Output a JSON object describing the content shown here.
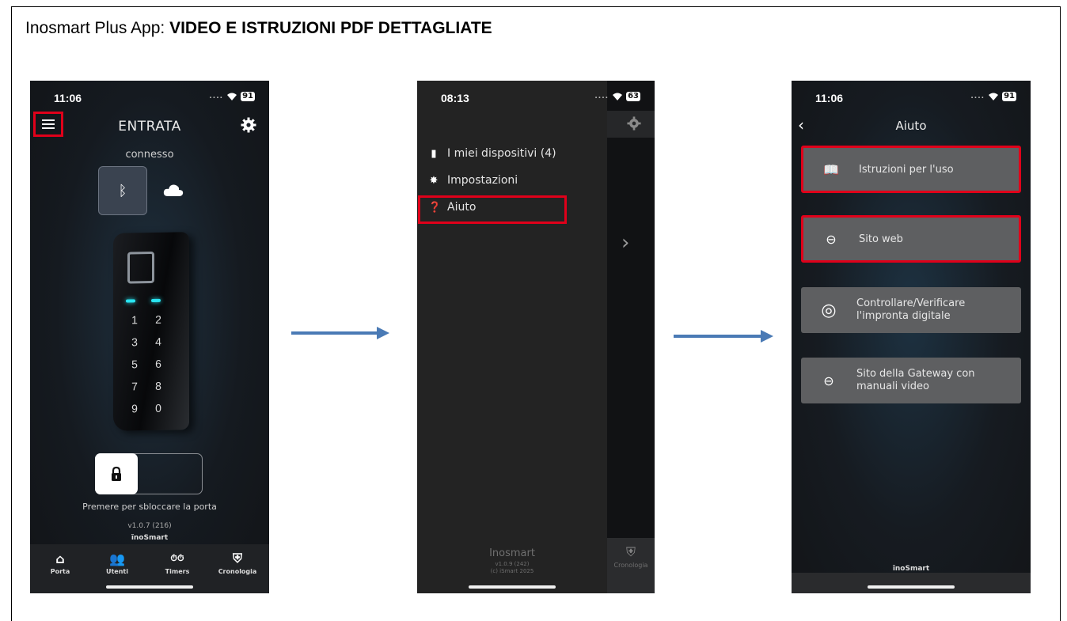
{
  "heading": {
    "prefix": "Inosmart Plus App: ",
    "bold": "VIDEO E ISTRUZIONI PDF DETTAGLIATE"
  },
  "phone1": {
    "time": "11:06",
    "battery": "91",
    "title": "ENTRATA",
    "status": "connesso",
    "keys": [
      "1",
      "2",
      "3",
      "4",
      "5",
      "6",
      "7",
      "8",
      "9",
      "0"
    ],
    "hint": "Premere per sbloccare la porta",
    "version": "v1.0.7 (216)",
    "brand": "ĩnoSmart",
    "tabs": [
      {
        "label": "Porta",
        "icon": "home-icon"
      },
      {
        "label": "Utenti",
        "icon": "users-icon"
      },
      {
        "label": "Timers",
        "icon": "timers-icon"
      },
      {
        "label": "Cronologia",
        "icon": "shield-lock-icon"
      }
    ]
  },
  "phone2": {
    "time": "08:13",
    "battery": "63",
    "menu": [
      {
        "label": "I miei dispositivi (4)",
        "icon": "door-icon"
      },
      {
        "label": "Impostazioni",
        "icon": "gear-icon"
      },
      {
        "label": "Aiuto",
        "icon": "help-icon"
      }
    ],
    "footer_brand": "Inosmart",
    "footer_version": "v1.0.9 (242)",
    "footer_copy": "(c) iSmart 2025",
    "under_tab": "Cronologia"
  },
  "phone3": {
    "time": "11:06",
    "battery": "91",
    "title": "Aiuto",
    "buttons": [
      {
        "label": "Istruzioni per l'uso",
        "icon": "book-icon"
      },
      {
        "label": "Sito web",
        "icon": "link-icon"
      },
      {
        "label": "Controllare/Verificare l'impronta digitale",
        "icon": "fingerprint-icon"
      },
      {
        "label": "Sito della Gateway con manuali video",
        "icon": "link-icon"
      }
    ],
    "brand": "ĩnoSmart"
  },
  "colors": {
    "highlight": "#e0001a",
    "arrow": "#4a7ab5"
  }
}
